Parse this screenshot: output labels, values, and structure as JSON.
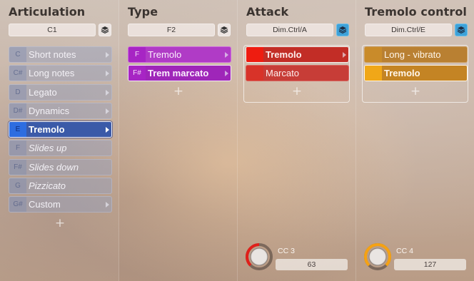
{
  "columns": {
    "articulation": {
      "title": "Articulation",
      "key": "C1",
      "items": [
        {
          "note": "C",
          "label": "Short notes"
        },
        {
          "note": "C#",
          "label": "Long notes"
        },
        {
          "note": "D",
          "label": "Legato"
        },
        {
          "note": "D#",
          "label": "Dynamics"
        },
        {
          "note": "E",
          "label": "Tremolo"
        },
        {
          "note": "F",
          "label": "Slides up"
        },
        {
          "note": "F#",
          "label": "Slides down"
        },
        {
          "note": "G",
          "label": "Pizzicato"
        },
        {
          "note": "G#",
          "label": "Custom"
        }
      ],
      "selected": "Tremolo",
      "add_icon": "plus-icon"
    },
    "type": {
      "title": "Type",
      "key": "F2",
      "items": [
        {
          "note": "F",
          "label": "Tremolo"
        },
        {
          "note": "F#",
          "label": "Trem marcato"
        }
      ],
      "selected": "Trem marcato",
      "add_icon": "plus-icon"
    },
    "attack": {
      "title": "Attack",
      "key": "Dim.Ctrl/A",
      "items": [
        {
          "label": "Tremolo"
        },
        {
          "label": "Marcato"
        }
      ],
      "selected": "Tremolo",
      "knob": {
        "cc_label": "CC 3",
        "value": "63",
        "level": 0.5
      },
      "add_icon": "plus-icon"
    },
    "tremolo_control": {
      "title": "Tremolo control",
      "key": "Dim.Ctrl/E",
      "items": [
        {
          "label": "Long - vibrato"
        },
        {
          "label": "Tremolo"
        }
      ],
      "selected": "Tremolo",
      "knob": {
        "cc_label": "CC 4",
        "value": "127",
        "level": 1.0
      },
      "add_icon": "plus-icon"
    }
  },
  "colors": {
    "articulation_item": "#96a0be",
    "articulation_selected": "#3b5aa8",
    "type_item": "#b03bc6",
    "attack_item": "#c73d37",
    "attack_swatch_active": "#ee1c10",
    "tremolo_item": "#b98032",
    "tremolo_swatch_active": "#f0a718",
    "layer_button_active": "#3ea2d9",
    "knob_red": "#e0201a",
    "knob_orange": "#f5a214"
  },
  "icons": {
    "layers": "layers-icon",
    "arrow": "chevron-right-icon",
    "knob": "knob-icon"
  }
}
